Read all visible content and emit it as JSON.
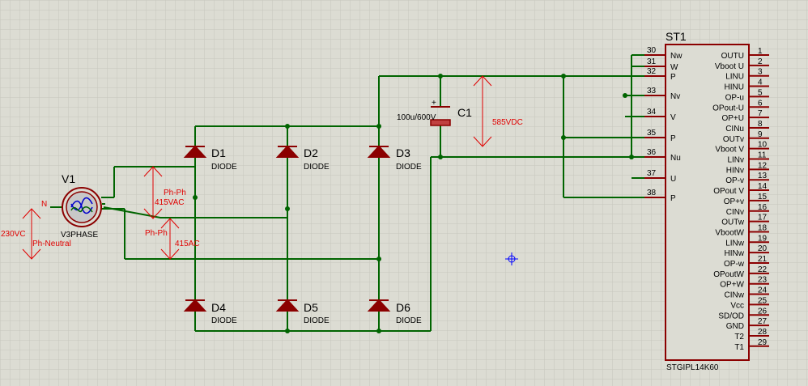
{
  "source": {
    "ref": "V1",
    "value": "V3PHASE",
    "neutral_label": "N",
    "voltage_label": "230VC",
    "voltage_desc": "Ph-Neutral",
    "phph_label_1": "Ph-Ph",
    "phph_value_1": "415VAC",
    "phph_label_2": "Ph-Ph",
    "phph_value_2": "415AC"
  },
  "diodes": [
    {
      "ref": "D1",
      "value": "DIODE"
    },
    {
      "ref": "D2",
      "value": "DIODE"
    },
    {
      "ref": "D3",
      "value": "DIODE"
    },
    {
      "ref": "D4",
      "value": "DIODE"
    },
    {
      "ref": "D5",
      "value": "DIODE"
    },
    {
      "ref": "D6",
      "value": "DIODE"
    }
  ],
  "capacitor": {
    "ref": "C1",
    "value": "100u/600V",
    "voltage": "585VDC"
  },
  "ic": {
    "ref": "ST1",
    "part": "STGIPL14K60",
    "left_pins": [
      {
        "num": "30",
        "name": "Nw"
      },
      {
        "num": "31",
        "name": "W"
      },
      {
        "num": "32",
        "name": "P"
      },
      {
        "num": "33",
        "name": "Nv"
      },
      {
        "num": "34",
        "name": "V"
      },
      {
        "num": "35",
        "name": "P"
      },
      {
        "num": "36",
        "name": "Nu"
      },
      {
        "num": "37",
        "name": "U"
      },
      {
        "num": "38",
        "name": "P"
      }
    ],
    "right_pins": [
      {
        "num": "1",
        "name": "OUTU"
      },
      {
        "num": "2",
        "name": "Vboot U"
      },
      {
        "num": "3",
        "name": "LINU"
      },
      {
        "num": "4",
        "name": "HINU"
      },
      {
        "num": "5",
        "name": "OP-u"
      },
      {
        "num": "6",
        "name": "OPout-U"
      },
      {
        "num": "7",
        "name": "OP+U"
      },
      {
        "num": "8",
        "name": "CINu"
      },
      {
        "num": "9",
        "name": "OUTv"
      },
      {
        "num": "10",
        "name": "Vboot V"
      },
      {
        "num": "11",
        "name": "LINv"
      },
      {
        "num": "12",
        "name": "HINv"
      },
      {
        "num": "13",
        "name": "OP-v"
      },
      {
        "num": "14",
        "name": "OPout V"
      },
      {
        "num": "15",
        "name": "OP+v"
      },
      {
        "num": "16",
        "name": "CINv"
      },
      {
        "num": "17",
        "name": "OUTw"
      },
      {
        "num": "18",
        "name": "VbootW"
      },
      {
        "num": "19",
        "name": "LINw"
      },
      {
        "num": "20",
        "name": "HINw"
      },
      {
        "num": "21",
        "name": "OP-w"
      },
      {
        "num": "22",
        "name": "OPoutW"
      },
      {
        "num": "23",
        "name": "OP+W"
      },
      {
        "num": "24",
        "name": "CINw"
      },
      {
        "num": "25",
        "name": "Vcc"
      },
      {
        "num": "26",
        "name": "SD/OD"
      },
      {
        "num": "27",
        "name": "GND"
      },
      {
        "num": "28",
        "name": "T2"
      },
      {
        "num": "29",
        "name": "T1"
      }
    ]
  },
  "colors": {
    "background": "#dcdcd3",
    "wire": "#006400",
    "component": "#8b0000",
    "annotation": "#e00000",
    "marker": "#0000ff"
  }
}
